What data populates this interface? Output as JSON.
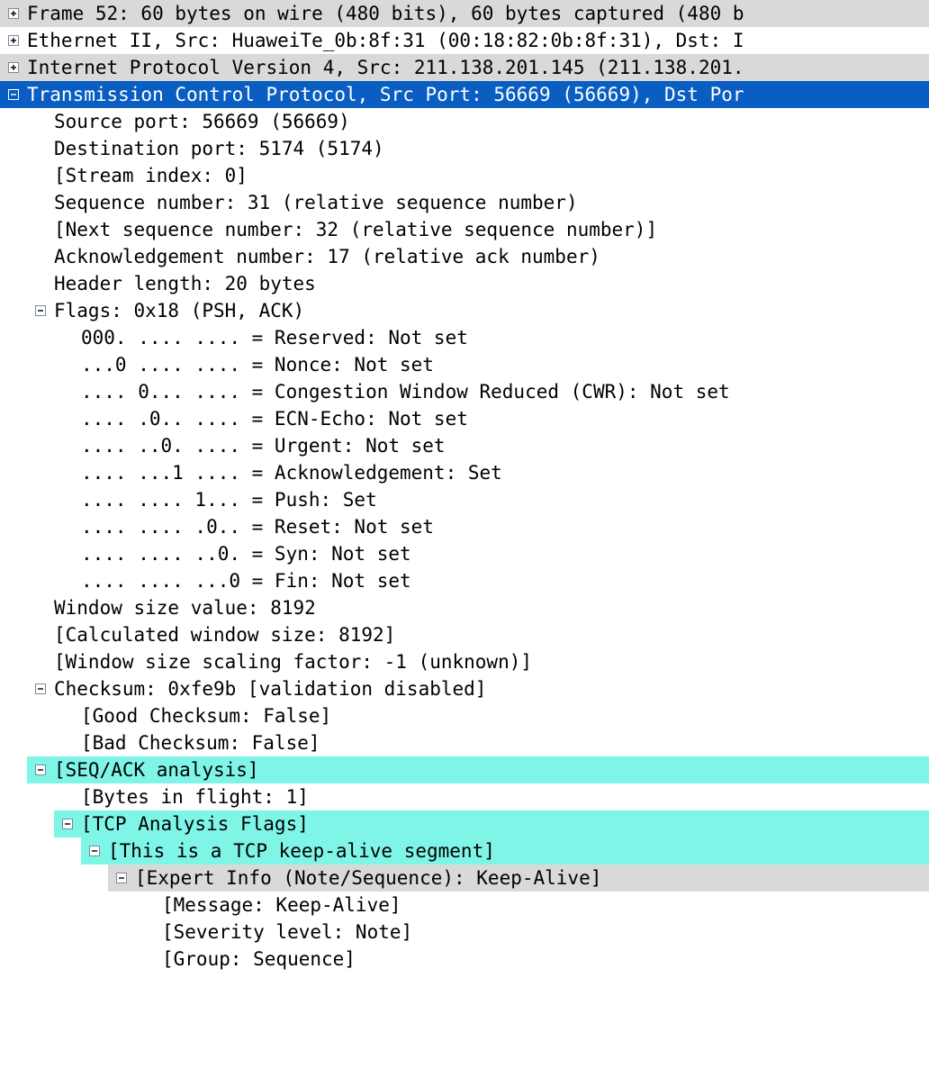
{
  "tree": [
    {
      "depth": 0,
      "exp": "plus",
      "text": "Frame 52: 60 bytes on wire (480 bits), 60 bytes captured (480 b",
      "bg": "grey",
      "int": true
    },
    {
      "depth": 0,
      "exp": "plus",
      "text": "Ethernet II, Src: HuaweiTe_0b:8f:31 (00:18:82:0b:8f:31), Dst: I",
      "bg": "",
      "int": true
    },
    {
      "depth": 0,
      "exp": "plus",
      "text": "Internet Protocol Version 4, Src: 211.138.201.145 (211.138.201.",
      "bg": "grey",
      "int": true
    },
    {
      "depth": 0,
      "exp": "minus",
      "text": "Transmission Control Protocol, Src Port: 56669 (56669), Dst Por",
      "bg": "sel",
      "int": true
    },
    {
      "depth": 1,
      "exp": "",
      "text": "Source port: 56669 (56669)",
      "bg": "",
      "int": true
    },
    {
      "depth": 1,
      "exp": "",
      "text": "Destination port: 5174 (5174)",
      "bg": "",
      "int": true
    },
    {
      "depth": 1,
      "exp": "",
      "text": "[Stream index: 0]",
      "bg": "",
      "int": true
    },
    {
      "depth": 1,
      "exp": "",
      "text": "Sequence number: 31    (relative sequence number)",
      "bg": "",
      "int": true
    },
    {
      "depth": 1,
      "exp": "",
      "text": "[Next sequence number: 32    (relative sequence number)]",
      "bg": "",
      "int": true
    },
    {
      "depth": 1,
      "exp": "",
      "text": "Acknowledgement number: 17    (relative ack number)",
      "bg": "",
      "int": true
    },
    {
      "depth": 1,
      "exp": "",
      "text": "Header length: 20 bytes",
      "bg": "",
      "int": true
    },
    {
      "depth": 1,
      "exp": "minus",
      "text": "Flags: 0x18 (PSH, ACK)",
      "bg": "",
      "int": true
    },
    {
      "depth": 2,
      "exp": "",
      "text": "000. .... .... = Reserved: Not set",
      "bg": "",
      "int": true
    },
    {
      "depth": 2,
      "exp": "",
      "text": "...0 .... .... = Nonce: Not set",
      "bg": "",
      "int": true
    },
    {
      "depth": 2,
      "exp": "",
      "text": ".... 0... .... = Congestion Window Reduced (CWR): Not set",
      "bg": "",
      "int": true
    },
    {
      "depth": 2,
      "exp": "",
      "text": ".... .0.. .... = ECN-Echo: Not set",
      "bg": "",
      "int": true
    },
    {
      "depth": 2,
      "exp": "",
      "text": ".... ..0. .... = Urgent: Not set",
      "bg": "",
      "int": true
    },
    {
      "depth": 2,
      "exp": "",
      "text": ".... ...1 .... = Acknowledgement: Set",
      "bg": "",
      "int": true
    },
    {
      "depth": 2,
      "exp": "",
      "text": ".... .... 1... = Push: Set",
      "bg": "",
      "int": true
    },
    {
      "depth": 2,
      "exp": "",
      "text": ".... .... .0.. = Reset: Not set",
      "bg": "",
      "int": true
    },
    {
      "depth": 2,
      "exp": "",
      "text": ".... .... ..0. = Syn: Not set",
      "bg": "",
      "int": true
    },
    {
      "depth": 2,
      "exp": "",
      "text": ".... .... ...0 = Fin: Not set",
      "bg": "",
      "int": true
    },
    {
      "depth": 1,
      "exp": "",
      "text": "Window size value: 8192",
      "bg": "",
      "int": true
    },
    {
      "depth": 1,
      "exp": "",
      "text": "[Calculated window size: 8192]",
      "bg": "",
      "int": true
    },
    {
      "depth": 1,
      "exp": "",
      "text": "[Window size scaling factor: -1 (unknown)]",
      "bg": "",
      "int": true
    },
    {
      "depth": 1,
      "exp": "minus",
      "text": "Checksum: 0xfe9b [validation disabled]",
      "bg": "",
      "int": true
    },
    {
      "depth": 2,
      "exp": "",
      "text": "[Good Checksum: False]",
      "bg": "",
      "int": true
    },
    {
      "depth": 2,
      "exp": "",
      "text": "[Bad Checksum: False]",
      "bg": "",
      "int": true
    },
    {
      "depth": 1,
      "exp": "minus",
      "text": "[SEQ/ACK analysis]",
      "bg": "cyan",
      "int": true
    },
    {
      "depth": 2,
      "exp": "",
      "text": "[Bytes in flight: 1]",
      "bg": "",
      "int": true
    },
    {
      "depth": 2,
      "exp": "minus",
      "text": "[TCP Analysis Flags]",
      "bg": "cyan",
      "int": true
    },
    {
      "depth": 3,
      "exp": "minus",
      "text": "[This is a TCP keep-alive segment]",
      "bg": "cyan",
      "int": true
    },
    {
      "depth": 4,
      "exp": "minus",
      "text": "[Expert Info (Note/Sequence): Keep-Alive]",
      "bg": "grey",
      "int": true
    },
    {
      "depth": 5,
      "exp": "",
      "text": "[Message: Keep-Alive]",
      "bg": "",
      "int": true
    },
    {
      "depth": 5,
      "exp": "",
      "text": "[Severity level: Note]",
      "bg": "",
      "int": true
    },
    {
      "depth": 5,
      "exp": "",
      "text": "[Group: Sequence]",
      "bg": "",
      "int": true
    }
  ],
  "icons": {
    "plus": "plus",
    "minus": "minus"
  }
}
